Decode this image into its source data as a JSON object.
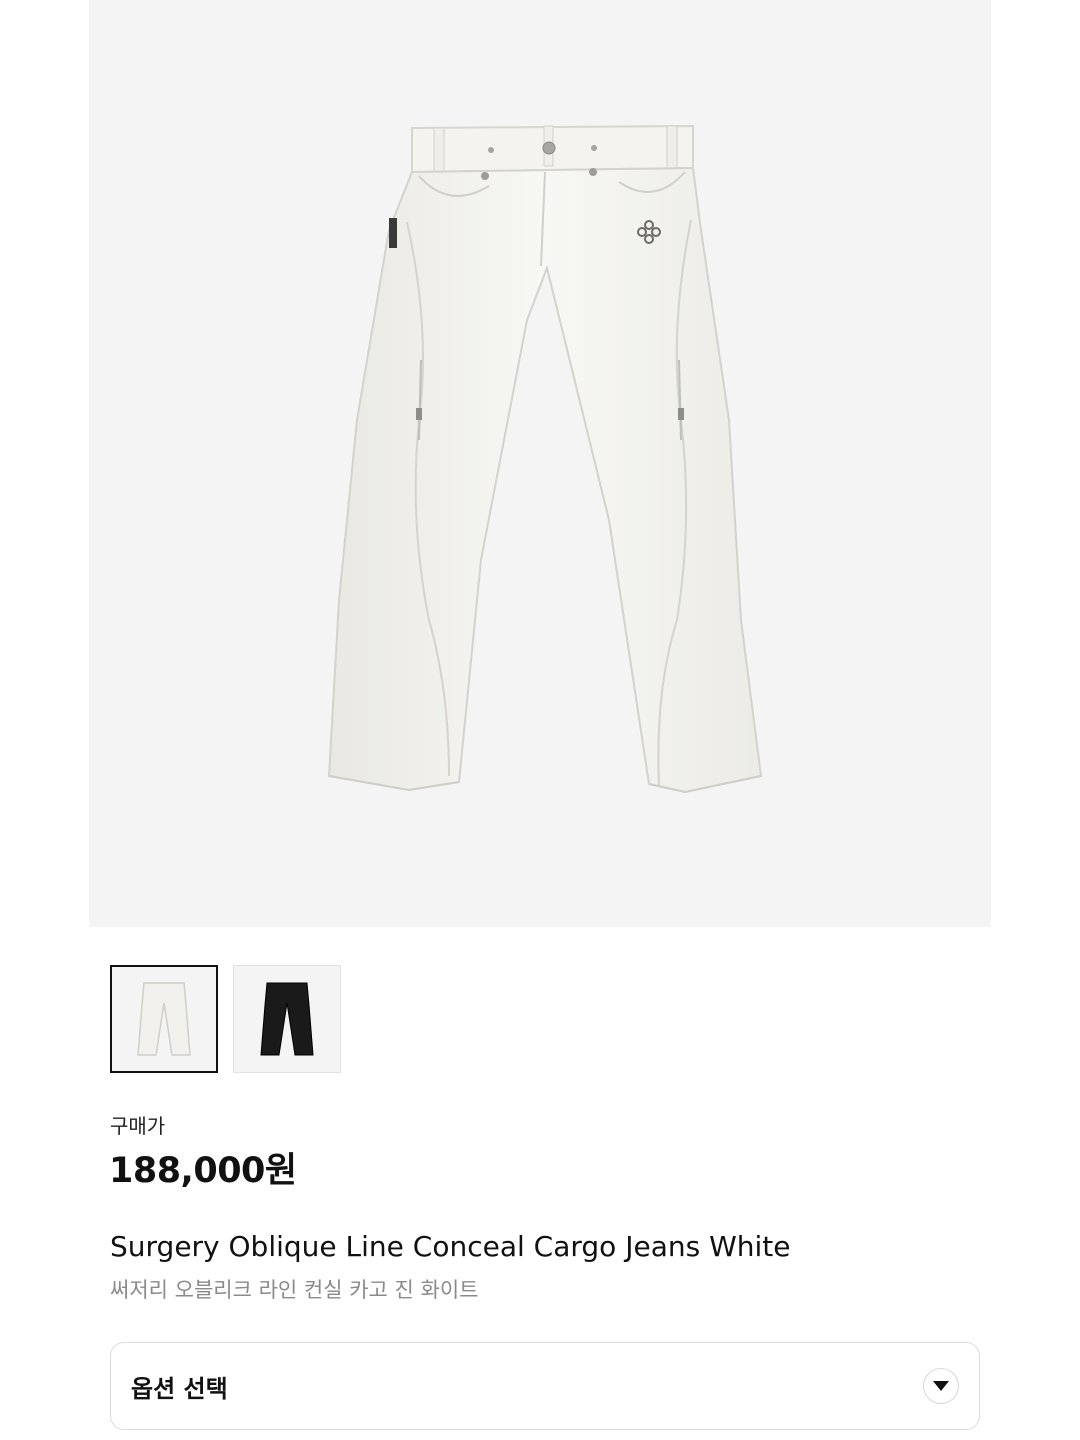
{
  "product": {
    "hero_image": "white-cargo-jeans-photo",
    "thumbnails": [
      {
        "name": "white-jeans-thumbnail",
        "color": "#f1f0ec",
        "selected": true
      },
      {
        "name": "black-jeans-thumbnail",
        "color": "#1a1a1a",
        "selected": false
      }
    ],
    "price_label": "구매가",
    "price": "188,000원",
    "name_en": "Surgery Oblique Line Conceal Cargo Jeans White",
    "name_ko": "써저리 오블리크 라인 컨실 카고 진 화이트"
  },
  "option": {
    "label": "옵션 선택",
    "icon": "chevron-down-icon"
  },
  "colors": {
    "image_background": "#f4f4f4",
    "text_primary": "#111111",
    "text_secondary": "#8a8a8a",
    "border": "#dcdcdc"
  }
}
